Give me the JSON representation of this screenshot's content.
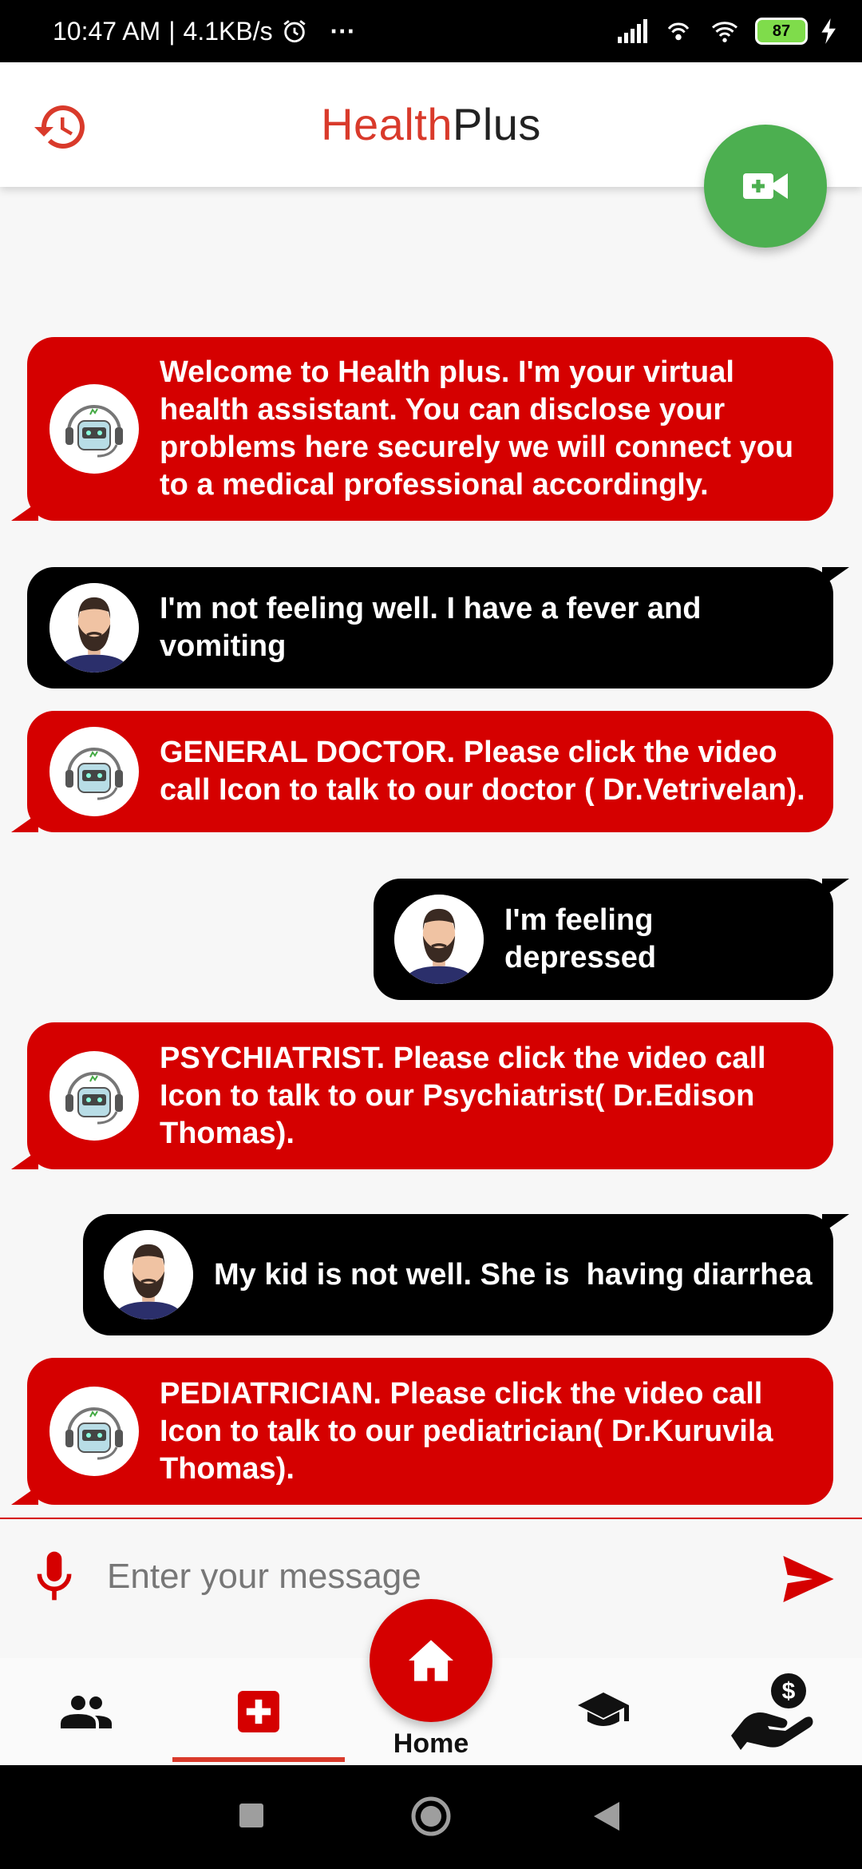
{
  "status_bar": {
    "time": "10:47 AM",
    "speed": "4.1KB/s",
    "more": "···",
    "battery": "87",
    "icons": [
      "alarm-icon",
      "signal-icon",
      "hotspot-icon",
      "wifi-icon",
      "battery-icon",
      "charging-icon"
    ]
  },
  "header": {
    "title_part1": "Health",
    "title_part2": "Plus",
    "left_icon": "history-icon",
    "fab_icon": "video-call-add-icon"
  },
  "colors": {
    "bot_bubble": "#d50000",
    "user_bubble": "#000000",
    "brand_red": "#d93a2b",
    "fab_green": "#4caf50"
  },
  "messages": [
    {
      "sender": "bot",
      "text": "Welcome to Health plus. I'm your virtual health assistant. You can disclose your problems here securely we will connect you to a medical professional accordingly."
    },
    {
      "sender": "user",
      "text": "I'm not feeling well. I have a fever and vomiting"
    },
    {
      "sender": "bot",
      "text": "GENERAL DOCTOR. Please click the video call Icon to talk to our doctor ( Dr.Vetrivelan)."
    },
    {
      "sender": "user",
      "text": "I'm feeling depressed"
    },
    {
      "sender": "bot",
      "text": "PSYCHIATRIST. Please click the video call Icon to talk to our Psychiatrist( Dr.Edison Thomas)."
    },
    {
      "sender": "user",
      "text": "My kid is not well. She is  having diarrhea"
    },
    {
      "sender": "bot",
      "text": "PEDIATRICIAN. Please click the video call Icon to talk to our pediatrician( Dr.Kuruvila Thomas)."
    }
  ],
  "input": {
    "placeholder": "Enter your message",
    "value": ""
  },
  "bottom_nav": {
    "items": [
      "people-icon",
      "medical-cross-icon",
      "home-icon",
      "graduation-cap-icon",
      "hand-money-icon"
    ],
    "home_label": "Home",
    "active": "medical-cross-icon"
  }
}
